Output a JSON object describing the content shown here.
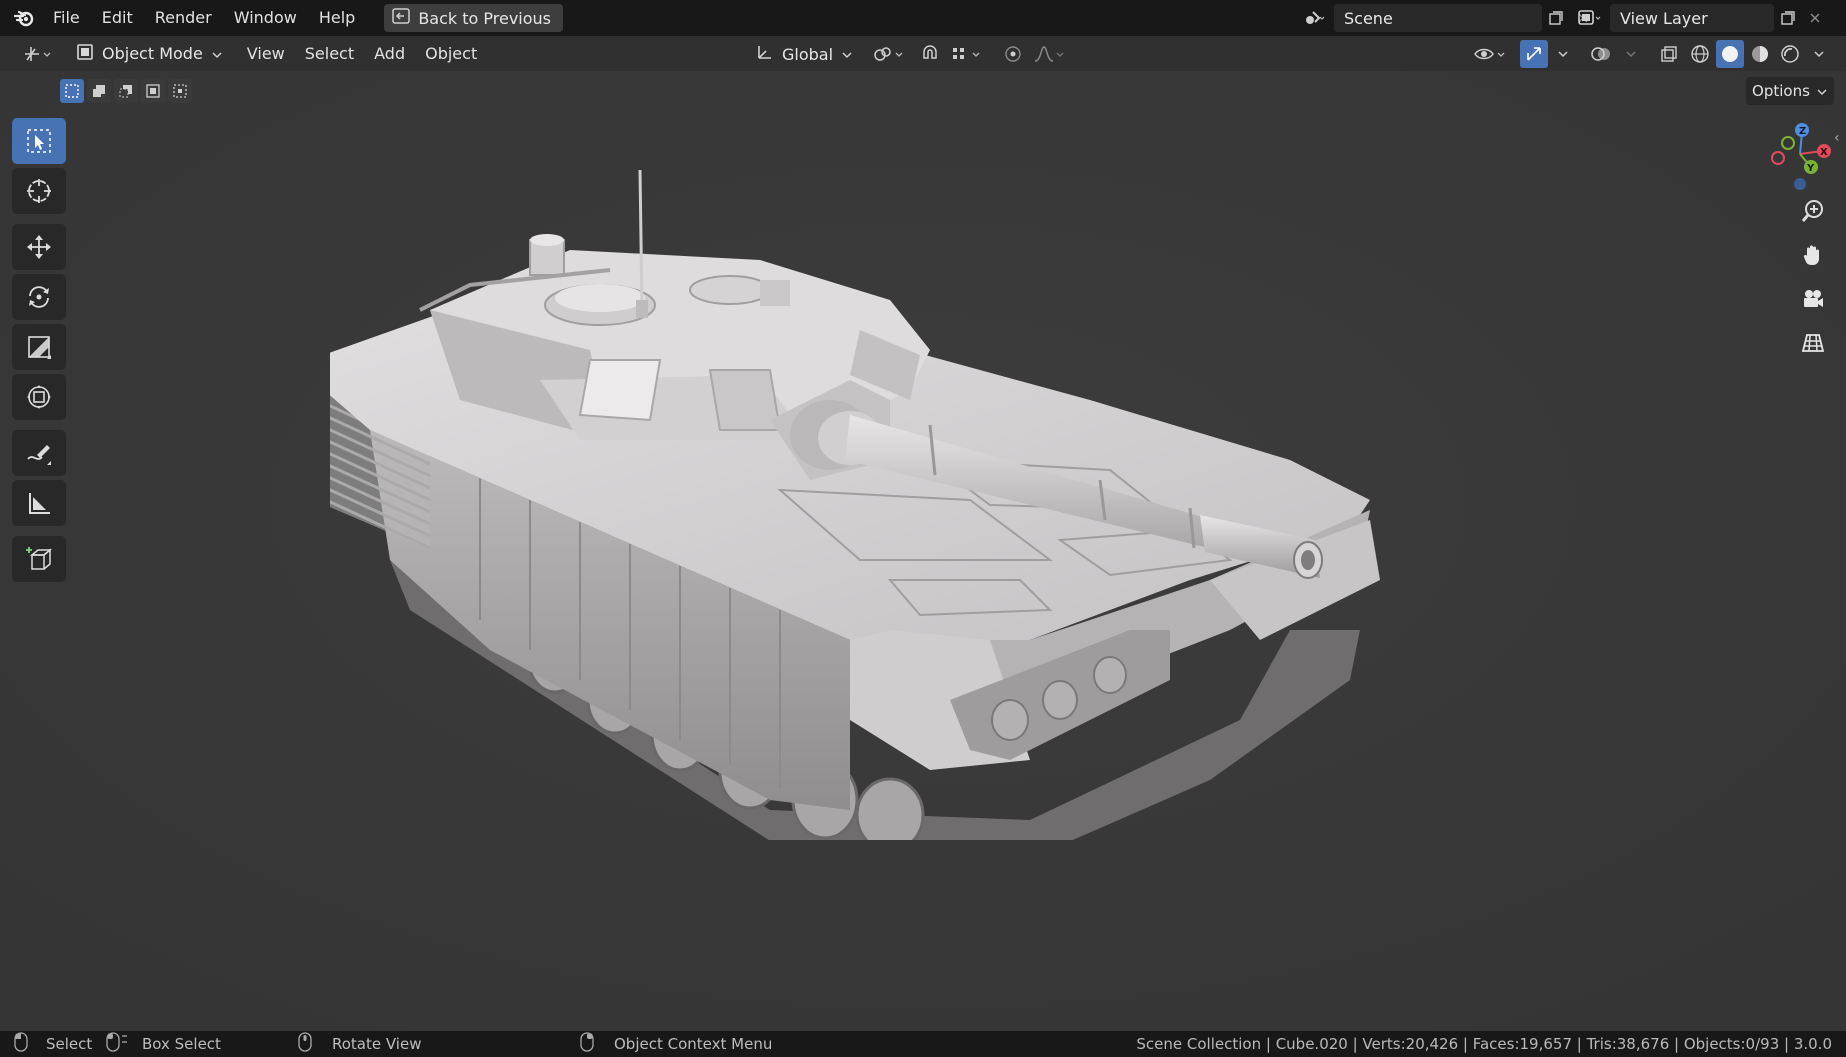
{
  "topbar": {
    "menu": [
      "File",
      "Edit",
      "Render",
      "Window",
      "Help"
    ],
    "back_button": "Back to Previous",
    "scene_name": "Scene",
    "view_layer_name": "View Layer"
  },
  "header": {
    "mode": "Object Mode",
    "menus": [
      "View",
      "Select",
      "Add",
      "Object"
    ],
    "transform_orientation": "Global",
    "options_label": "Options"
  },
  "statusbar": {
    "select": "Select",
    "box_select": "Box Select",
    "rotate_view": "Rotate View",
    "context_menu": "Object Context Menu",
    "stats": "Scene Collection | Cube.020 | Verts:20,426 | Faces:19,657 | Tris:38,676 | Objects:0/93 | 3.0.0"
  },
  "colors": {
    "accent": "#4772b3",
    "background": "#3b3b3b",
    "panel": "#181818",
    "axis_x": "#e04a5a",
    "axis_y": "#7bb236",
    "axis_z": "#4d8ee0"
  },
  "icons": {
    "toolbar": [
      "select-box-icon",
      "cursor-icon",
      "move-icon",
      "rotate-icon",
      "scale-icon",
      "transform-icon",
      "annotate-icon",
      "measure-icon",
      "add-cube-icon"
    ],
    "nav": [
      "zoom-icon",
      "hand-pan-icon",
      "camera-icon",
      "grid-ortho-icon"
    ]
  }
}
